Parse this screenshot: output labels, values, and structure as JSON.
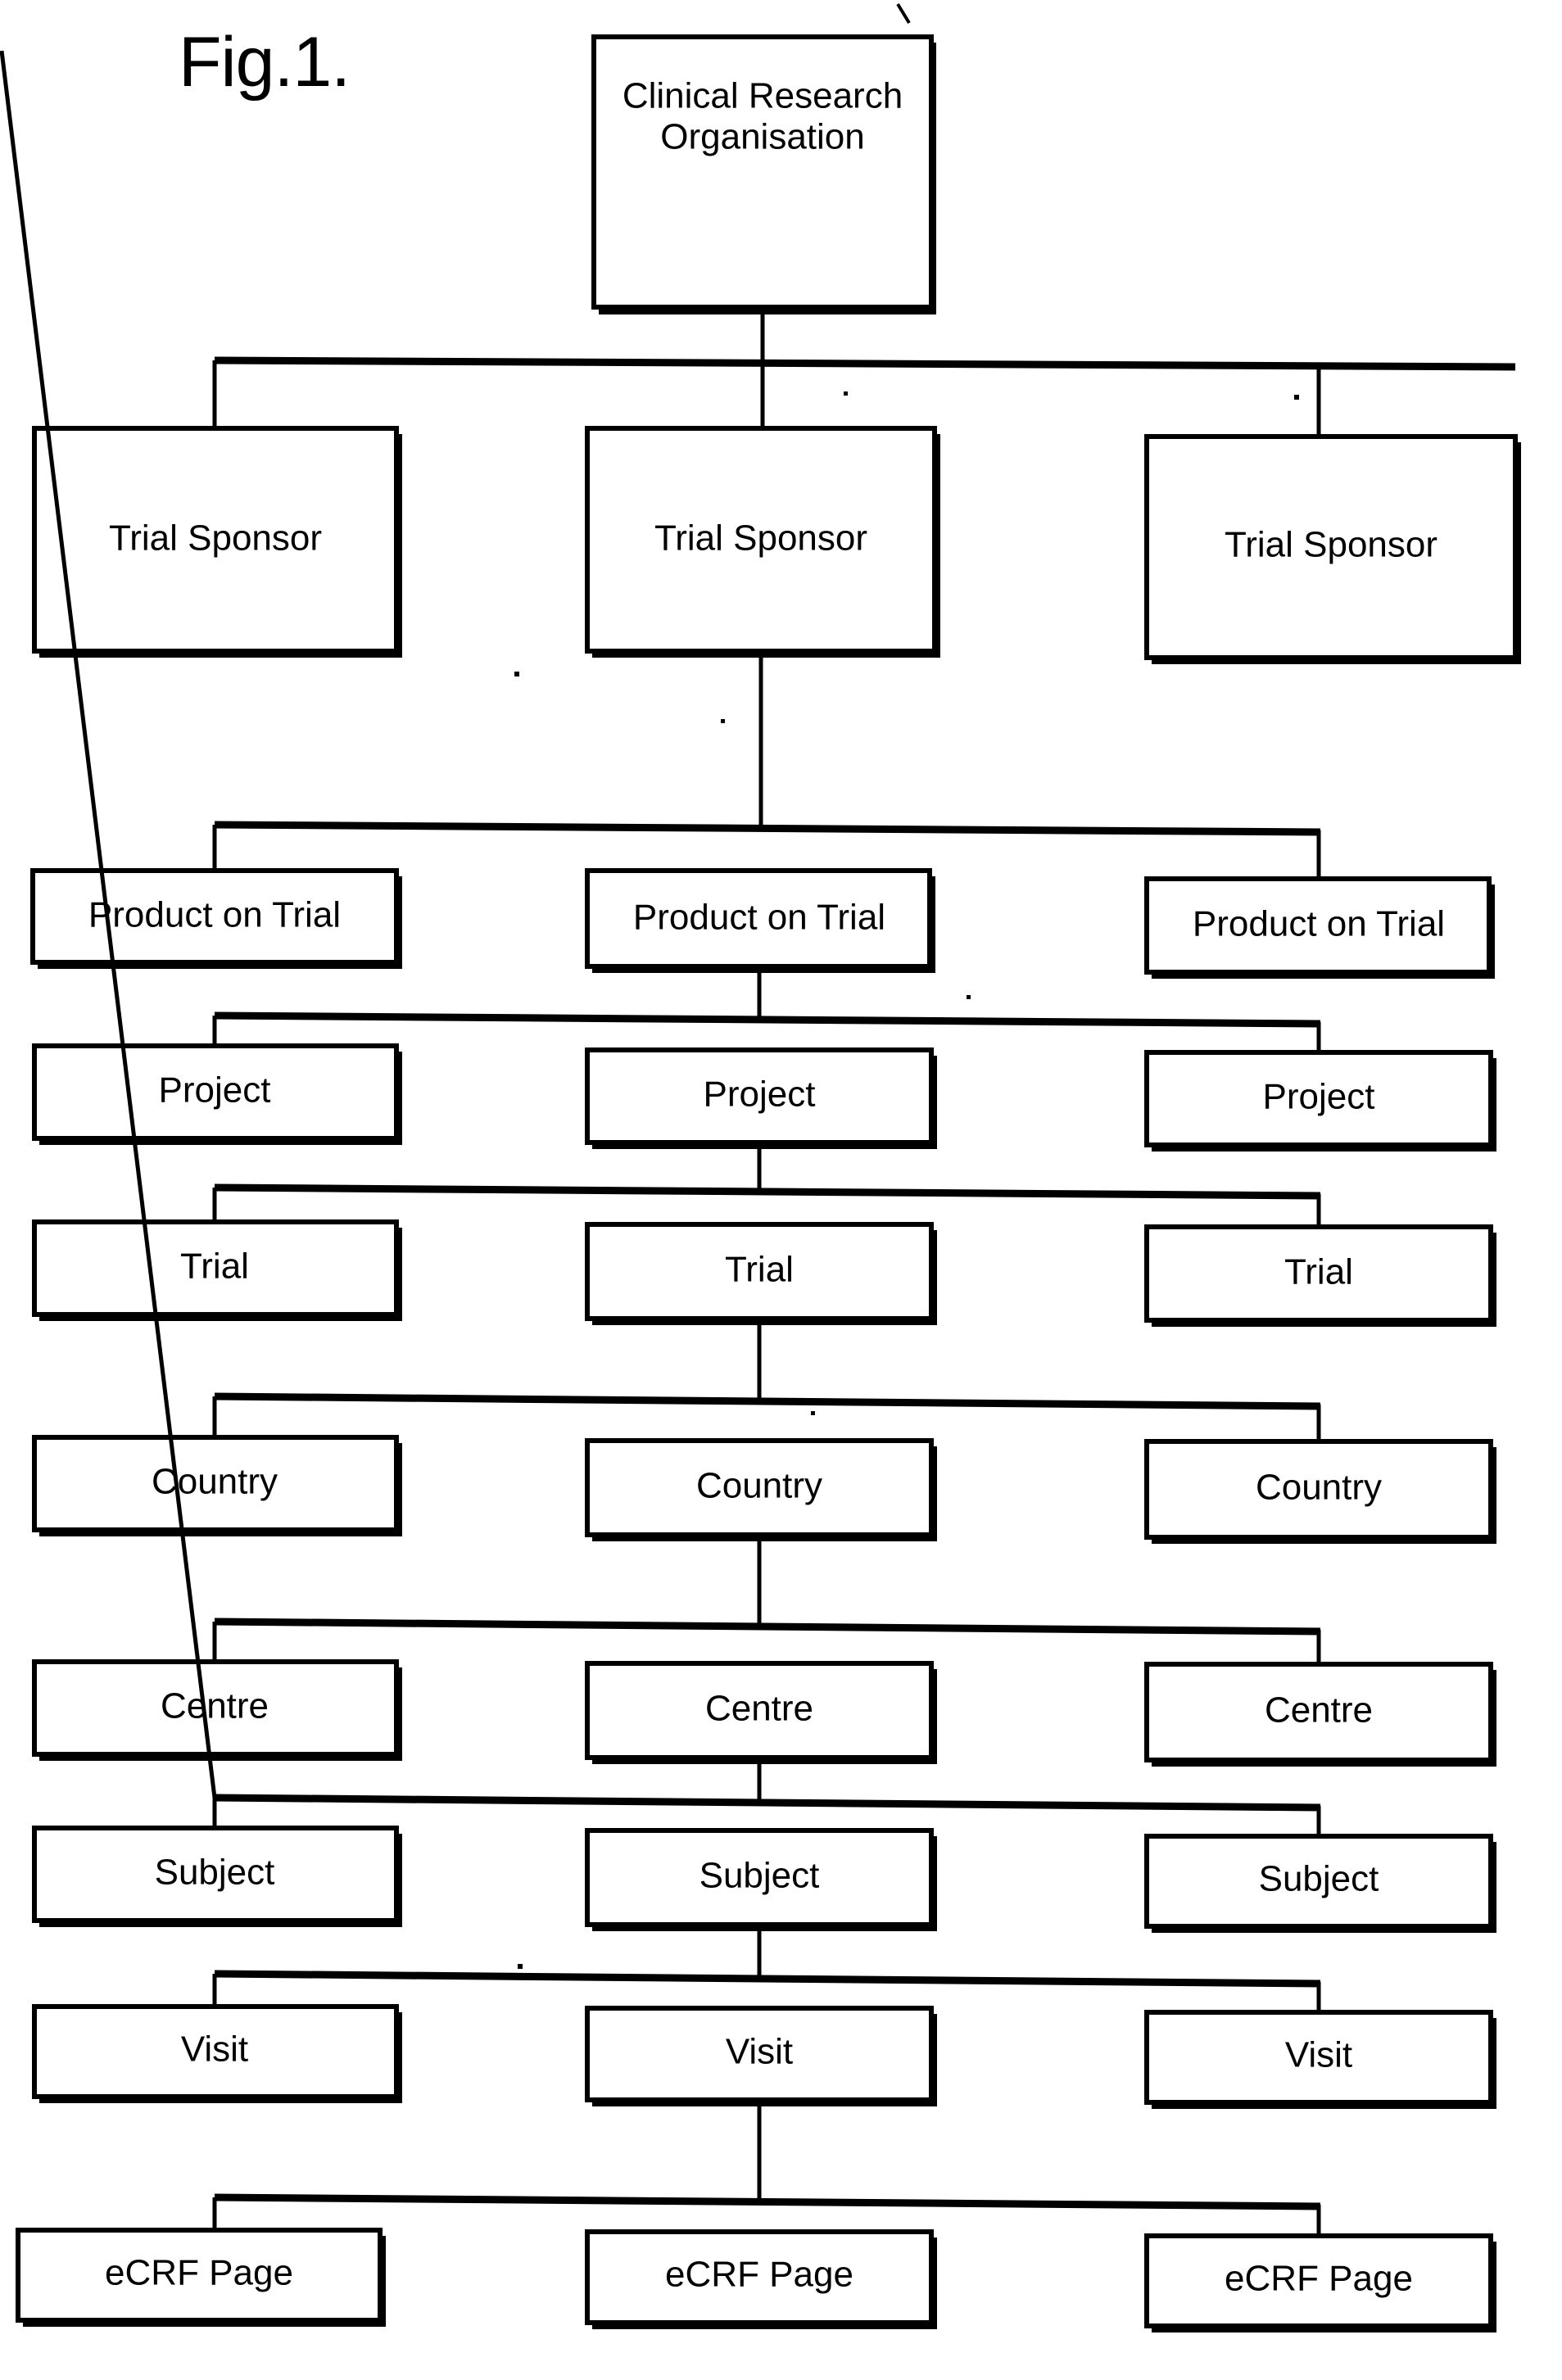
{
  "figure": {
    "title": "Fig.1.",
    "reference_numeral_mark": "/",
    "diagram_type": "hierarchical-tree-org-chart",
    "columns": 3,
    "line_color": "#000000",
    "box_fill": "#ffffff",
    "background": "#ffffff"
  },
  "root": {
    "label_line1": "Clinical Research",
    "label_line2": "Organisation"
  },
  "levels": [
    {
      "level": 1,
      "name": "trial-sponsor",
      "nodes": [
        {
          "label": "Trial Sponsor"
        },
        {
          "label": "Trial Sponsor"
        },
        {
          "label": "Trial Sponsor"
        }
      ]
    },
    {
      "level": 2,
      "name": "product-on-trial",
      "nodes": [
        {
          "label": "Product on Trial"
        },
        {
          "label": "Product on Trial"
        },
        {
          "label": "Product on Trial"
        }
      ]
    },
    {
      "level": 3,
      "name": "project",
      "nodes": [
        {
          "label": "Project"
        },
        {
          "label": "Project"
        },
        {
          "label": "Project"
        }
      ]
    },
    {
      "level": 4,
      "name": "trial",
      "nodes": [
        {
          "label": "Trial"
        },
        {
          "label": "Trial"
        },
        {
          "label": "Trial"
        }
      ]
    },
    {
      "level": 5,
      "name": "country",
      "nodes": [
        {
          "label": "Country"
        },
        {
          "label": "Country"
        },
        {
          "label": "Country"
        }
      ]
    },
    {
      "level": 6,
      "name": "centre",
      "nodes": [
        {
          "label": "Centre"
        },
        {
          "label": "Centre"
        },
        {
          "label": "Centre"
        }
      ]
    },
    {
      "level": 7,
      "name": "subject",
      "nodes": [
        {
          "label": "Subject"
        },
        {
          "label": "Subject"
        },
        {
          "label": "Subject"
        }
      ]
    },
    {
      "level": 8,
      "name": "visit",
      "nodes": [
        {
          "label": "Visit"
        },
        {
          "label": "Visit"
        },
        {
          "label": "Visit"
        }
      ]
    },
    {
      "level": 9,
      "name": "ecrf-page",
      "nodes": [
        {
          "label": "eCRF Page"
        },
        {
          "label": "eCRF Page"
        },
        {
          "label": "eCRF Page"
        }
      ]
    }
  ]
}
